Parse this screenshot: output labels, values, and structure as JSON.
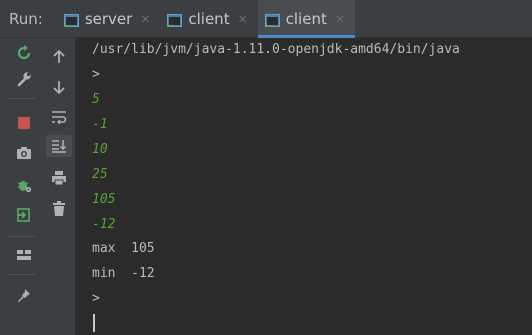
{
  "run_label": "Run:",
  "tabs": [
    {
      "label": "server",
      "close": "×"
    },
    {
      "label": "client",
      "close": "×"
    },
    {
      "label": "client",
      "close": "×"
    }
  ],
  "console": {
    "path": "/usr/lib/jvm/java-1.11.0-openjdk-amd64/bin/java",
    "prompt1": ">",
    "inputs": [
      "5",
      "-1",
      "10",
      "25",
      "105",
      "-12"
    ],
    "max_line": "max  105",
    "min_line": "min  -12",
    "prompt2": ">"
  },
  "colors": {
    "background": "#2b2b2b",
    "toolbar": "#3c3f41",
    "input_text": "#5a9e3a",
    "active_tab_underline": "#4a88c7"
  },
  "toolbar_icons": {
    "left": [
      "rerun-icon",
      "wrench-icon",
      "stop-icon",
      "camera-icon",
      "bug-gear-icon",
      "exit-icon",
      "layout-icon",
      "pin-icon"
    ],
    "right": [
      "up-arrow-icon",
      "down-arrow-icon",
      "soft-wrap-icon",
      "scroll-to-end-icon",
      "print-icon",
      "trash-icon"
    ]
  }
}
